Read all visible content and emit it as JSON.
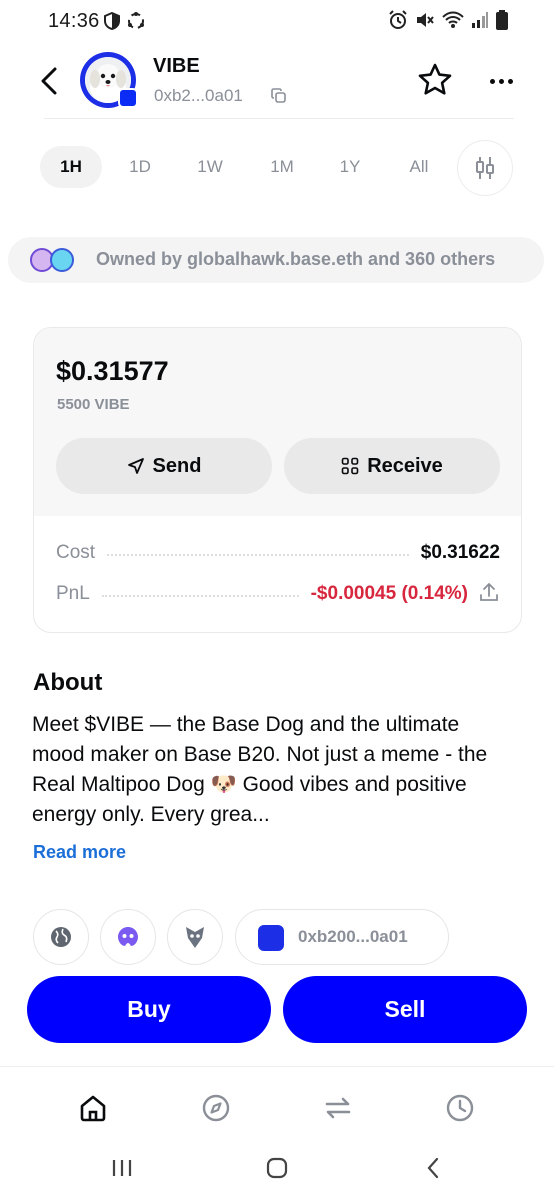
{
  "status_bar": {
    "time": "14:36"
  },
  "header": {
    "token_name": "VIBE",
    "token_address": "0xb2...0a01",
    "icons": {
      "back": "back-arrow-icon",
      "copy": "copy-icon",
      "favorite": "star-icon",
      "more": "more-icon"
    }
  },
  "time_ranges": {
    "selected": "1H",
    "items": [
      "1H",
      "1D",
      "1W",
      "1M",
      "1Y",
      "All"
    ]
  },
  "owned_by": {
    "text": "Owned by globalhawk.base.eth and 360 others"
  },
  "holdings": {
    "value": "$0.31577",
    "amount": "5500 VIBE",
    "send_label": "Send",
    "receive_label": "Receive",
    "cost_label": "Cost",
    "cost_value": "$0.31622",
    "pnl_label": "PnL",
    "pnl_value": "-$0.00045 (0.14%)",
    "colors": {
      "negative": "#d7263d"
    }
  },
  "about": {
    "title": "About",
    "text": "Meet $VIBE — the Base Dog and the ultimate mood maker on Base B20. Not just a meme - the Real Maltipoo Dog 🐶 Good vibes and positive energy only. Every grea...",
    "read_more": "Read more"
  },
  "links": {
    "icons": [
      "globe-icon",
      "farcaster-icon",
      "basescan-icon"
    ],
    "contract_address": "0xb200...0a01"
  },
  "trade": {
    "buy_label": "Buy",
    "sell_label": "Sell",
    "accent_color": "#0000ff"
  },
  "bottom_nav": {
    "items": [
      "home-icon",
      "explore-icon",
      "swap-icon",
      "history-icon"
    ],
    "active": "home-icon"
  }
}
